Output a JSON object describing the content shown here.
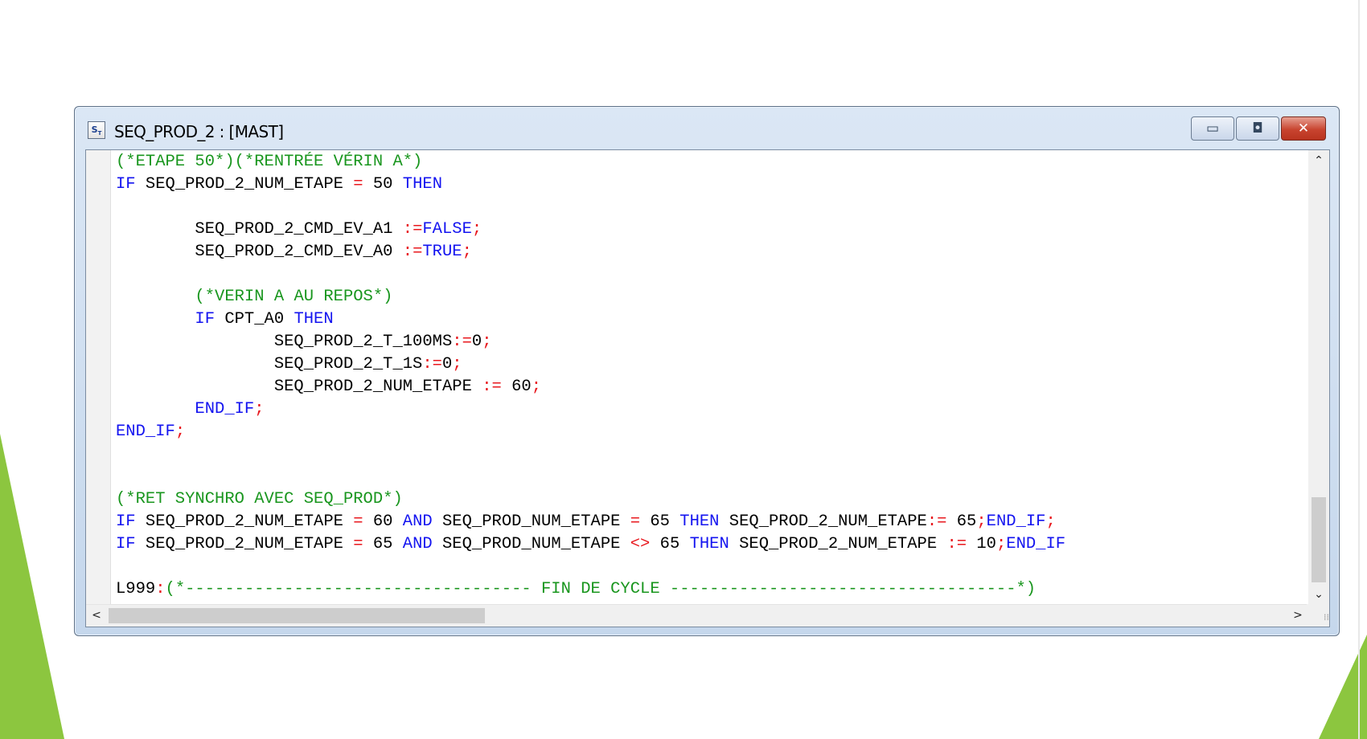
{
  "colors": {
    "keyword": "#1414f0",
    "comment": "#19961e",
    "operator": "#e8181e",
    "identifier": "#000000",
    "background_accent": "#8cc63f"
  },
  "window": {
    "title": "SEQ_PROD_2 : [MAST]",
    "icon_glyph": "S",
    "icon_sub": "T",
    "buttons": {
      "minimize_icon": "minimize-icon",
      "maximize_icon": "maximize-icon",
      "close_icon": "close-icon",
      "minimize_glyph": "▭",
      "maximize_glyph": "◘",
      "close_glyph": "✕"
    }
  },
  "editor": {
    "lines": [
      [
        {
          "t": "(*ETAPE 50*)",
          "c": "cm"
        },
        {
          "t": "(*RENTRÉE VÉRIN A*)",
          "c": "cm"
        }
      ],
      [
        {
          "t": "IF",
          "c": "kw"
        },
        {
          "t": " SEQ_PROD_2_NUM_ETAPE ",
          "c": "id"
        },
        {
          "t": "=",
          "c": "op"
        },
        {
          "t": " 50 ",
          "c": "id"
        },
        {
          "t": "THEN",
          "c": "kw"
        }
      ],
      [],
      [
        {
          "t": "        SEQ_PROD_2_CMD_EV_A1 ",
          "c": "id"
        },
        {
          "t": ":=",
          "c": "op"
        },
        {
          "t": "FALSE",
          "c": "kw"
        },
        {
          "t": ";",
          "c": "op"
        }
      ],
      [
        {
          "t": "        SEQ_PROD_2_CMD_EV_A0 ",
          "c": "id"
        },
        {
          "t": ":=",
          "c": "op"
        },
        {
          "t": "TRUE",
          "c": "kw"
        },
        {
          "t": ";",
          "c": "op"
        }
      ],
      [],
      [
        {
          "t": "        ",
          "c": "id"
        },
        {
          "t": "(*VERIN A AU REPOS*)",
          "c": "cm"
        }
      ],
      [
        {
          "t": "        ",
          "c": "id"
        },
        {
          "t": "IF",
          "c": "kw"
        },
        {
          "t": " CPT_A0 ",
          "c": "id"
        },
        {
          "t": "THEN",
          "c": "kw"
        }
      ],
      [
        {
          "t": "                SEQ_PROD_2_T_100MS",
          "c": "id"
        },
        {
          "t": ":=",
          "c": "op"
        },
        {
          "t": "0",
          "c": "id"
        },
        {
          "t": ";",
          "c": "op"
        }
      ],
      [
        {
          "t": "                SEQ_PROD_2_T_1S",
          "c": "id"
        },
        {
          "t": ":=",
          "c": "op"
        },
        {
          "t": "0",
          "c": "id"
        },
        {
          "t": ";",
          "c": "op"
        }
      ],
      [
        {
          "t": "                SEQ_PROD_2_NUM_ETAPE ",
          "c": "id"
        },
        {
          "t": ":=",
          "c": "op"
        },
        {
          "t": " 60",
          "c": "id"
        },
        {
          "t": ";",
          "c": "op"
        }
      ],
      [
        {
          "t": "        ",
          "c": "id"
        },
        {
          "t": "END_IF",
          "c": "kw"
        },
        {
          "t": ";",
          "c": "op"
        }
      ],
      [
        {
          "t": "END_IF",
          "c": "kw"
        },
        {
          "t": ";",
          "c": "op"
        }
      ],
      [],
      [],
      [
        {
          "t": "(*RET SYNCHRO AVEC SEQ_PROD*)",
          "c": "cm"
        }
      ],
      [
        {
          "t": "IF",
          "c": "kw"
        },
        {
          "t": " SEQ_PROD_2_NUM_ETAPE ",
          "c": "id"
        },
        {
          "t": "=",
          "c": "op"
        },
        {
          "t": " 60 ",
          "c": "id"
        },
        {
          "t": "AND",
          "c": "kw"
        },
        {
          "t": " SEQ_PROD_NUM_ETAPE ",
          "c": "id"
        },
        {
          "t": "=",
          "c": "op"
        },
        {
          "t": " 65 ",
          "c": "id"
        },
        {
          "t": "THEN",
          "c": "kw"
        },
        {
          "t": " SEQ_PROD_2_NUM_ETAPE",
          "c": "id"
        },
        {
          "t": ":=",
          "c": "op"
        },
        {
          "t": " 65",
          "c": "id"
        },
        {
          "t": ";",
          "c": "op"
        },
        {
          "t": "END_IF",
          "c": "kw"
        },
        {
          "t": ";",
          "c": "op"
        }
      ],
      [
        {
          "t": "IF",
          "c": "kw"
        },
        {
          "t": " SEQ_PROD_2_NUM_ETAPE ",
          "c": "id"
        },
        {
          "t": "=",
          "c": "op"
        },
        {
          "t": " 65 ",
          "c": "id"
        },
        {
          "t": "AND",
          "c": "kw"
        },
        {
          "t": " SEQ_PROD_NUM_ETAPE ",
          "c": "id"
        },
        {
          "t": "<>",
          "c": "op"
        },
        {
          "t": " 65 ",
          "c": "id"
        },
        {
          "t": "THEN",
          "c": "kw"
        },
        {
          "t": " SEQ_PROD_2_NUM_ETAPE ",
          "c": "id"
        },
        {
          "t": ":=",
          "c": "op"
        },
        {
          "t": " 10",
          "c": "id"
        },
        {
          "t": ";",
          "c": "op"
        },
        {
          "t": "END_IF",
          "c": "kw"
        }
      ],
      [],
      [
        {
          "t": "L999",
          "c": "id"
        },
        {
          "t": ":",
          "c": "op"
        },
        {
          "t": "(*----------------------------------- FIN DE CYCLE -----------------------------------*)",
          "c": "cm"
        }
      ]
    ]
  },
  "scrollbars": {
    "up_glyph": "⌃",
    "down_glyph": "⌄",
    "left_glyph": "<",
    "right_glyph": ">",
    "grip_glyph": "⁞⁞"
  }
}
